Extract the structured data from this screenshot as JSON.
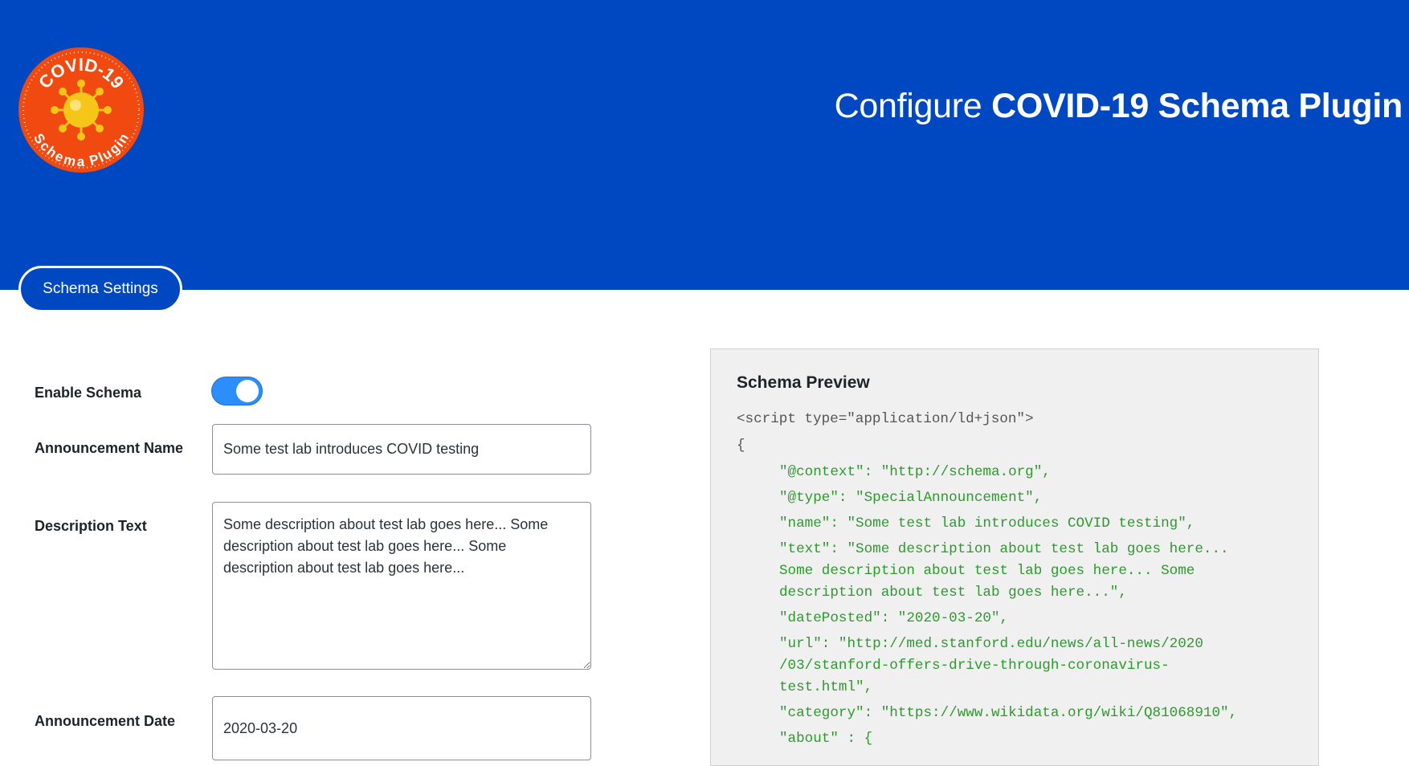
{
  "header": {
    "title_light": "Configure",
    "title_bold": "COVID-19 Schema Plugin"
  },
  "logo": {
    "text_top": "COVID-19",
    "text_bottom": "Schema Plugin",
    "colors": {
      "badge": "#f04a10",
      "virus": "#f5c518",
      "text": "#ffffff"
    }
  },
  "tabs": [
    {
      "label": "Schema Settings",
      "active": true
    }
  ],
  "form": {
    "enable_schema_label": "Enable Schema",
    "enable_schema_on": true,
    "announcement_name_label": "Announcement Name",
    "announcement_name_value": "Some test lab introduces COVID testing",
    "description_label": "Description Text",
    "description_value": "Some description about test lab goes here... Some description about test lab goes here... Some description about test lab goes here...",
    "date_label": "Announcement Date",
    "date_value": "2020-03-20"
  },
  "preview": {
    "title": "Schema Preview",
    "open_tag": "<script type=\"application/ld+json\">",
    "open_brace": "{",
    "lines": [
      "\"@context\": \"http://schema.org\",",
      "\"@type\": \"SpecialAnnouncement\",",
      "\"name\": \"Some test lab introduces COVID testing\",",
      "\"text\": \"Some description about test lab goes here...",
      "Some description about test lab goes here... Some",
      "description about test lab goes here...\",",
      "\"datePosted\": \"2020-03-20\",",
      "\"url\": \"http://med.stanford.edu/news/all-news/2020",
      "/03/stanford-offers-drive-through-coronavirus-",
      "test.html\",",
      "\"category\": \"https://www.wikidata.org/wiki/Q81068910\",",
      "\"about\" : {"
    ]
  },
  "colors": {
    "header_bg": "#0047c2",
    "toggle_on": "#2c8ef8",
    "code_string": "#2c9b2c",
    "preview_bg": "#f0f0f0"
  }
}
